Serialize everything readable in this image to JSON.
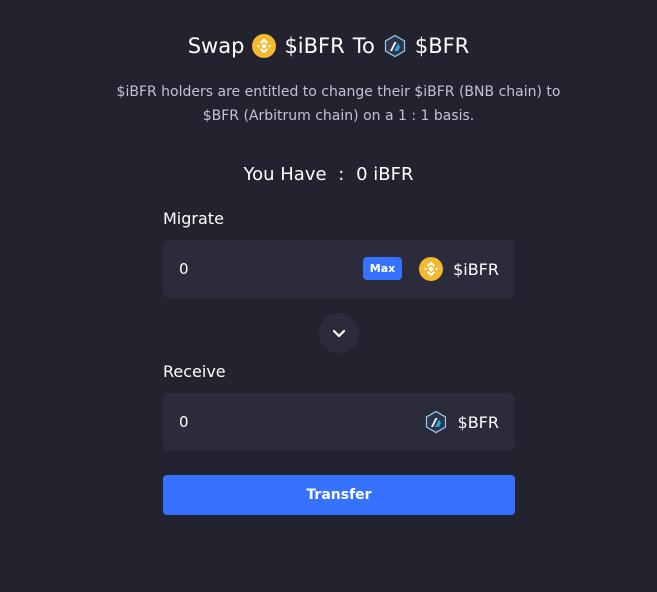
{
  "title": {
    "prefix": "Swap",
    "from_token": "$iBFR",
    "connector": "To",
    "to_token": "$BFR"
  },
  "description": "$iBFR holders are entitled to change their $iBFR (BNB chain) to $BFR (Arbitrum chain) on a 1 : 1 basis.",
  "balance": {
    "label": "You Have",
    "separator": ":",
    "value": "0 iBFR"
  },
  "migrate": {
    "label": "Migrate",
    "value": "0",
    "max_label": "Max",
    "token": "$iBFR",
    "token_icon": "bnb-coin-icon"
  },
  "receive": {
    "label": "Receive",
    "value": "0",
    "token": "$BFR",
    "token_icon": "arbitrum-icon"
  },
  "switch_icon": "chevron-down-icon",
  "transfer_label": "Transfer",
  "colors": {
    "background": "#232330",
    "field": "#2b2b3c",
    "accent": "#3772ff",
    "bnb": "#f3ba2f",
    "arbitrum": "#2d374b",
    "muted_text": "#c3c2d4"
  }
}
